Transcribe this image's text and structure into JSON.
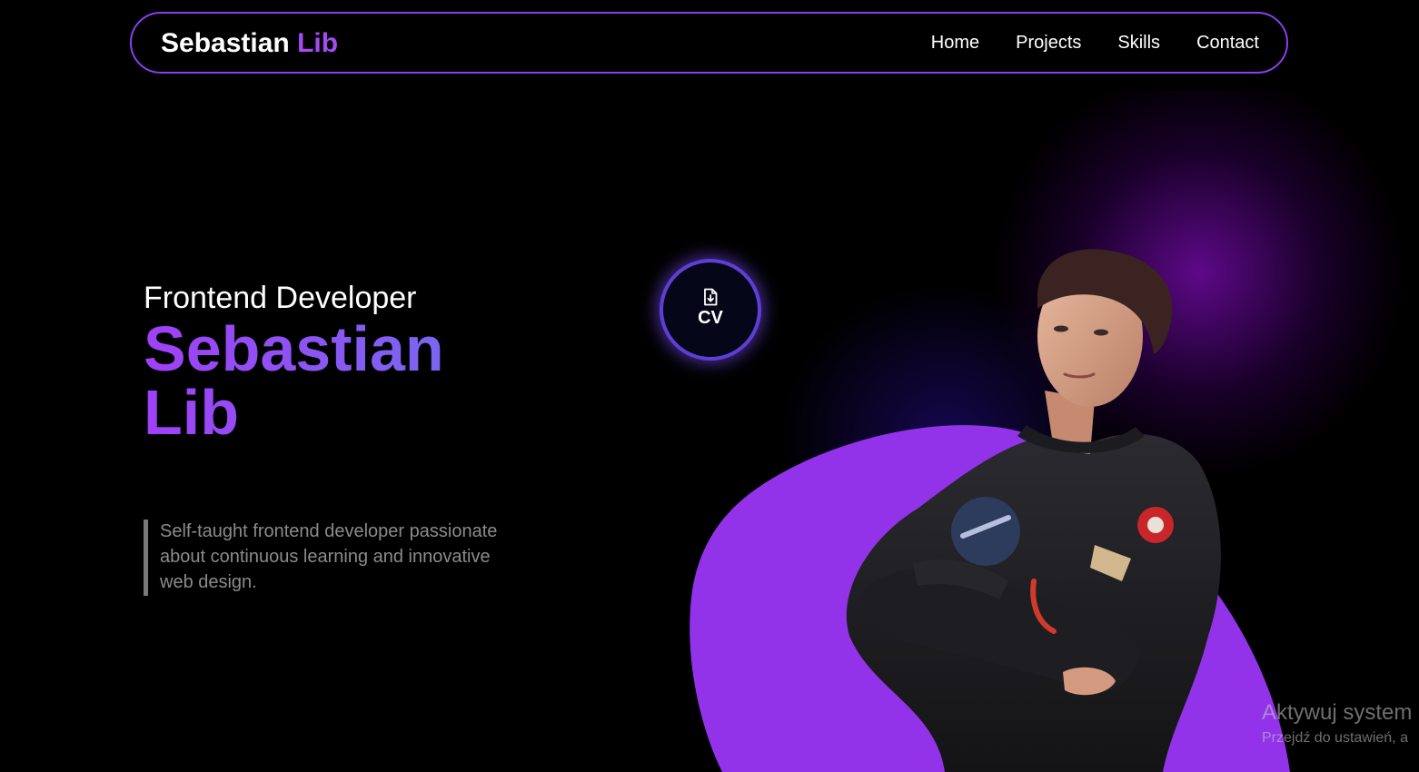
{
  "nav": {
    "logo_first": "Sebastian",
    "logo_last": "Lib",
    "items": [
      {
        "label": "Home"
      },
      {
        "label": "Projects"
      },
      {
        "label": "Skills"
      },
      {
        "label": "Contact"
      }
    ]
  },
  "hero": {
    "role": "Frontend Developer",
    "name_first": "Sebastian",
    "name_last": "Lib",
    "intro": "Self-taught frontend developer passionate about continuous learning and innovative web design."
  },
  "cv_button": {
    "label": "CV",
    "icon": "file-download-icon"
  },
  "watermark": {
    "title": "Aktywuj system",
    "subtitle": "Przejdź do ustawień, a"
  },
  "colors": {
    "accent": "#a44cf2",
    "blob": "#9233ea",
    "nav_border": "#8b3ff0",
    "background": "#000000"
  }
}
